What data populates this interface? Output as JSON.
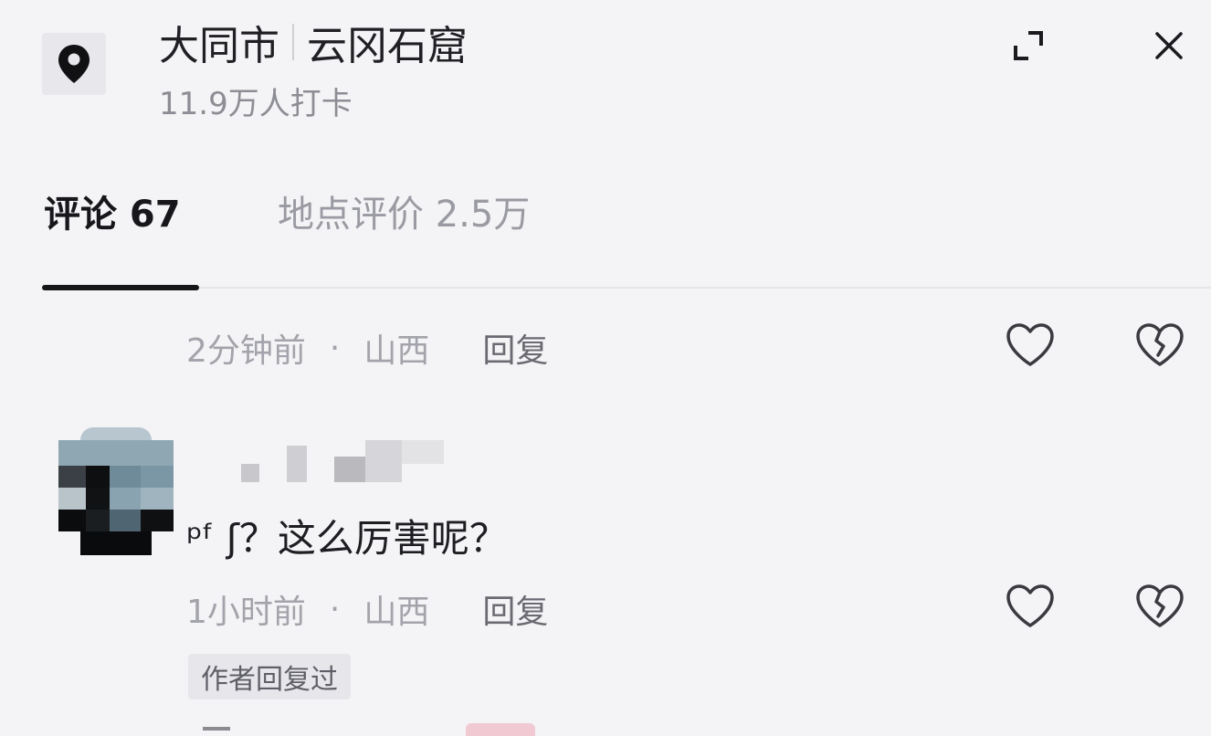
{
  "header": {
    "city": "大同市",
    "place": "云冈石窟",
    "checkins": "11.9万人打卡",
    "location_icon": "map-pin-icon",
    "expand_icon": "expand-icon",
    "close_icon": "close-icon"
  },
  "tabs": [
    {
      "label": "评论 67",
      "active": true
    },
    {
      "label": "地点评价 2.5万",
      "active": false
    }
  ],
  "comments": [
    {
      "time": "2分钟前",
      "dot": "·",
      "region": "山西",
      "reply_label": "回复"
    },
    {
      "text": "ᵖᶠ ʃ？这么厉害呢？",
      "time": "1小时前",
      "dot": "·",
      "region": "山西",
      "reply_label": "回复",
      "author_badge": "作者回复过"
    }
  ],
  "icons": {
    "like": "heart-icon",
    "dislike": "broken-heart-icon"
  },
  "colors": {
    "background": "#f4f4f6",
    "active_tab": "#16161a",
    "muted_text": "#a3a3ab"
  }
}
